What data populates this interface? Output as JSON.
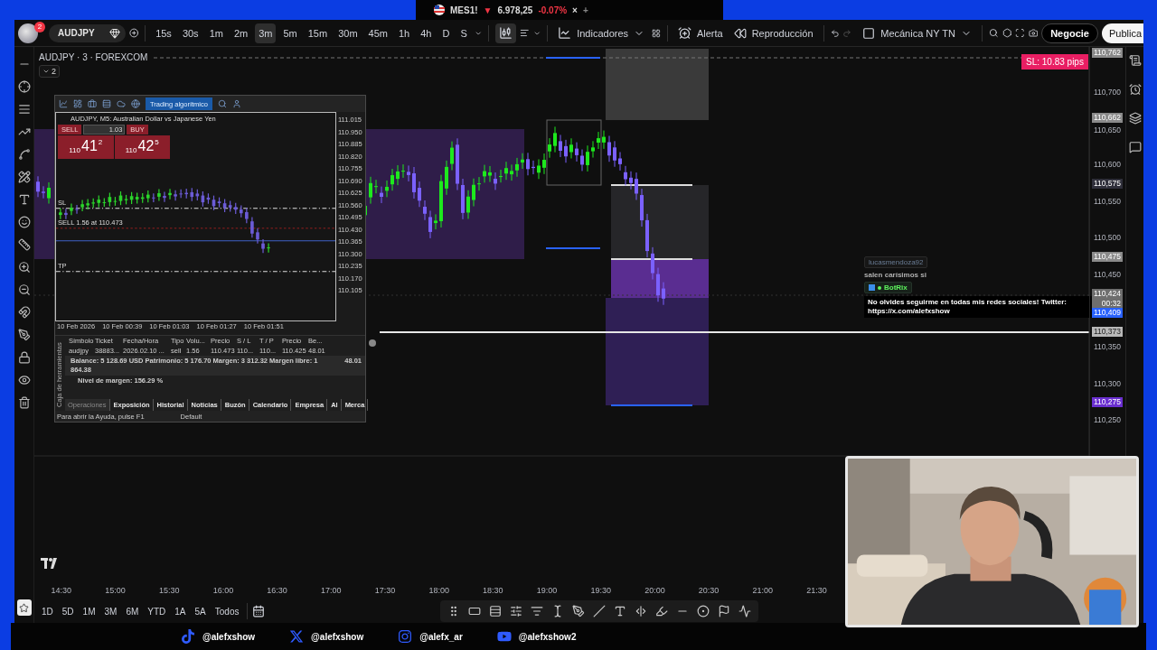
{
  "top_tab": {
    "symbol": "MES1!",
    "arrow": "▼",
    "price": "6.978,25",
    "change": "-0.07%",
    "close": "×",
    "add": "+"
  },
  "toolbar": {
    "badge": "2",
    "symbol": "AUDJPY",
    "intervals": [
      {
        "label": "15s",
        "selected": false
      },
      {
        "label": "30s",
        "selected": false
      },
      {
        "label": "1m",
        "selected": false
      },
      {
        "label": "2m",
        "selected": false
      },
      {
        "label": "3m",
        "selected": true
      },
      {
        "label": "5m",
        "selected": false
      },
      {
        "label": "15m",
        "selected": false
      },
      {
        "label": "30m",
        "selected": false
      },
      {
        "label": "45m",
        "selected": false
      },
      {
        "label": "1h",
        "selected": false
      },
      {
        "label": "4h",
        "selected": false
      },
      {
        "label": "D",
        "selected": false
      },
      {
        "label": "S",
        "selected": false
      }
    ],
    "indicators": "Indicadores",
    "alert": "Alerta",
    "replay": "Reproducción",
    "layout": "Mecánica NY TN",
    "trade": "Negocie",
    "publish": "Publica"
  },
  "chart": {
    "title": "AUDJPY · 3 · FOREXCOM",
    "collapse": "2",
    "sl_badge": "SL: 10.83 pips",
    "price_axis": [
      {
        "label": "110,762",
        "kind": "tag",
        "color": "#8a8a8a"
      },
      {
        "label": "110,700",
        "kind": "plain"
      },
      {
        "label": "110,662",
        "kind": "tag",
        "color": "#8a8a8a"
      },
      {
        "label": "110,650",
        "kind": "plain"
      },
      {
        "label": "110,600",
        "kind": "plain"
      },
      {
        "label": "110,575",
        "kind": "tag",
        "color": "#2f2f3a"
      },
      {
        "label": "110,550",
        "kind": "plain"
      },
      {
        "label": "110,500",
        "kind": "plain"
      },
      {
        "label": "110,475",
        "kind": "tag",
        "color": "#8a8a8a"
      },
      {
        "label": "110,450",
        "kind": "plain"
      },
      {
        "label": "110,424",
        "kind": "tag",
        "color": "#6e6e6e",
        "sub": "00:32"
      },
      {
        "label": "110,409",
        "kind": "tag",
        "color": "#2962ff"
      },
      {
        "label": "110,373",
        "kind": "tag",
        "color": "#b8b8b8"
      },
      {
        "label": "110,350",
        "kind": "plain"
      },
      {
        "label": "110,300",
        "kind": "plain"
      },
      {
        "label": "110,275",
        "kind": "tag",
        "color": "#6a2fd0"
      },
      {
        "label": "110,250",
        "kind": "plain"
      }
    ],
    "time_axis": [
      "14:30",
      "15:00",
      "15:30",
      "16:00",
      "16:30",
      "17:00",
      "17:30",
      "18:00",
      "18:30",
      "19:00",
      "19:30",
      "20:00",
      "20:30",
      "21:00",
      "21:30"
    ]
  },
  "chat": [
    {
      "kind": "user",
      "name": "lucasmendoza92",
      "text": "salen carísimos si"
    },
    {
      "kind": "bot",
      "name": "BotRix",
      "text": "No olvides seguirme en todas mis redes sociales! Twitter: https://x.com/alefxshow"
    }
  ],
  "mt_window": {
    "toolbar_button": "Trading algorítmico",
    "chart_title": "AUDJPY, M5: Australian Dollar vs Japanese Yen",
    "sell": "SELL",
    "buy": "BUY",
    "lot": "1.03",
    "bid": {
      "big": "110",
      "main": "41",
      "sup": "2"
    },
    "ask": {
      "big": "110",
      "main": "42",
      "sup": "5"
    },
    "order_label": "SELL 1.56 at 110.473",
    "sl": "SL",
    "tp": "TP",
    "prices": [
      "111.015",
      "110.950",
      "110.885",
      "110.820",
      "110.755",
      "110.690",
      "110.625",
      "110.560",
      "110.495",
      "110.430",
      "110.365",
      "110.300",
      "110.235",
      "110.170",
      "110.105"
    ],
    "times": [
      "10 Feb 2026",
      "10 Feb 00:39",
      "10 Feb 01:03",
      "10 Feb 01:27",
      "10 Feb 01:51"
    ],
    "columns": [
      "Símbolo",
      "Ticket",
      "Fecha/Hora",
      "Tipo",
      "Volu...",
      "Precio",
      "S / L",
      "T / P",
      "Precio",
      "Be..."
    ],
    "row": [
      "audjpy",
      "38883...",
      "2026.02.10 ...",
      "sell",
      "1.56",
      "110.473",
      "110...",
      "110...",
      "110.425",
      "48.01"
    ],
    "balance": "Balance: 5 128.69 USD  Patrimonio: 5 176.70  Margen: 3 312.32  Margen libre: 1 864.38",
    "balance_profit": "48.01",
    "margin_level": "Nivel de margen: 156.29 %",
    "side_label": "Caja de herramientas",
    "tabs": [
      {
        "label": "Operaciones",
        "selected": true
      },
      {
        "label": "Exposición",
        "selected": false
      },
      {
        "label": "Historial",
        "selected": false
      },
      {
        "label": "Noticias",
        "selected": false
      },
      {
        "label": "Buzón",
        "selected": false
      },
      {
        "label": "Calendario",
        "selected": false
      },
      {
        "label": "Empresa",
        "selected": false
      },
      {
        "label": "Al",
        "selected": false
      },
      {
        "label": "Merca",
        "selected": false
      }
    ],
    "status": "Para abrir la Ayuda, pulse F1",
    "status_profile": "Default"
  },
  "ranges": [
    "1D",
    "5D",
    "1M",
    "3M",
    "6M",
    "YTD",
    "1A",
    "5A",
    "Todos"
  ],
  "socials": [
    {
      "kind": "tiktok",
      "handle": "@alefxshow"
    },
    {
      "kind": "x",
      "handle": "@alefxshow"
    },
    {
      "kind": "instagram",
      "handle": "@alefx_ar"
    },
    {
      "kind": "youtube",
      "handle": "@alefxshow2"
    }
  ],
  "webcam": {
    "kind": "picture"
  }
}
